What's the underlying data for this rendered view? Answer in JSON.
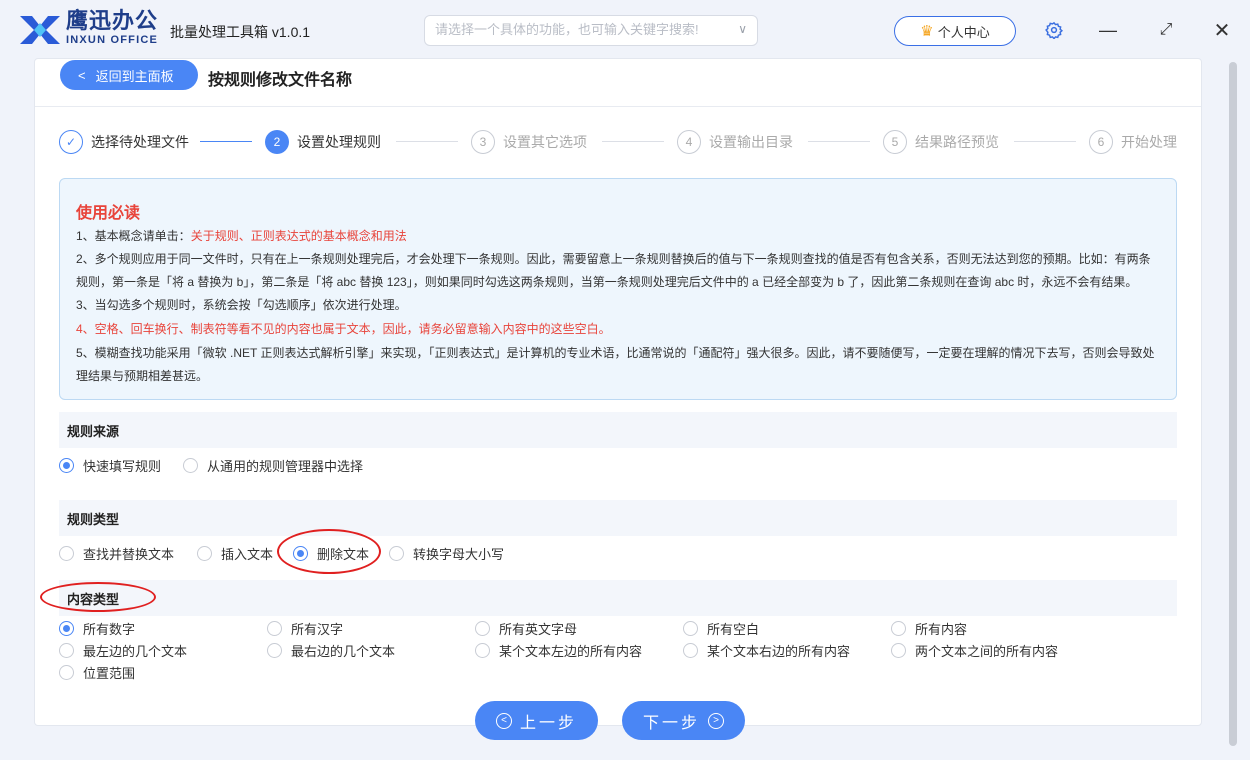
{
  "app": {
    "brand_cn": "鹰迅办公",
    "brand_en": "INXUN OFFICE",
    "title": "批量处理工具箱 v1.0.1",
    "search_placeholder": "请选择一个具体的功能，也可输入关键字搜索!",
    "user_center": "个人中心",
    "colors": {
      "accent": "#4a86f5",
      "brand": "#1f3e8a",
      "warning": "#e8443b"
    }
  },
  "header": {
    "back_label": "返回到主面板",
    "page_title": "按规则修改文件名称"
  },
  "steps": [
    {
      "num": "✓",
      "label": "选择待处理文件",
      "state": "done"
    },
    {
      "num": "2",
      "label": "设置处理规则",
      "state": "active"
    },
    {
      "num": "3",
      "label": "设置其它选项",
      "state": "pending"
    },
    {
      "num": "4",
      "label": "设置输出目录",
      "state": "pending"
    },
    {
      "num": "5",
      "label": "结果路径预览",
      "state": "pending"
    },
    {
      "num": "6",
      "label": "开始处理",
      "state": "pending"
    }
  ],
  "notice": {
    "title": "使用必读",
    "line1_prefix": "1、基本概念请单击：",
    "line1_link": "关于规则、正则表达式的基本概念和用法",
    "line2a": "2、多个规则应用于同一文件时，只有在上一条规则处理完后，才会处理下一条规则。因此，需要留意上一条规则替换后的值与下一条规则查找的值是否有包含关系，否则无法达到您的预期。比如：有两条",
    "line2b": "规则，第一条是「将 a 替换为 b」，第二条是「将 abc 替换 123」，则如果同时勾选这两条规则，当第一条规则处理完后文件中的 a 已经全部变为 b 了，因此第二条规则在查询 abc 时，永远不会有结果。",
    "line3": "3、当勾选多个规则时，系统会按「勾选顺序」依次进行处理。",
    "line4": "4、空格、回车换行、制表符等看不见的内容也属于文本，因此，请务必留意输入内容中的这些空白。",
    "line5a": "5、模糊查找功能采用「微软 .NET 正则表达式解析引擎」来实现，「正则表达式」是计算机的专业术语，比通常说的「通配符」强大很多。因此，请不要随便写，一定要在理解的情况下去写，否则会导致处",
    "line5b": "理结果与预期相差甚远。"
  },
  "rule_source": {
    "title": "规则来源",
    "options": [
      "快速填写规则",
      "从通用的规则管理器中选择"
    ],
    "selected": "快速填写规则"
  },
  "rule_type": {
    "title": "规则类型",
    "options": [
      "查找并替换文本",
      "插入文本",
      "删除文本",
      "转换字母大小写"
    ],
    "selected": "删除文本"
  },
  "content_type": {
    "title": "内容类型",
    "options": [
      "所有数字",
      "所有汉字",
      "所有英文字母",
      "所有空白",
      "所有内容",
      "最左边的几个文本",
      "最右边的几个文本",
      "某个文本左边的所有内容",
      "某个文本右边的所有内容",
      "两个文本之间的所有内容",
      "位置范围"
    ],
    "selected": "所有数字"
  },
  "footer": {
    "prev_label": "上一步",
    "next_label": "下一步"
  }
}
